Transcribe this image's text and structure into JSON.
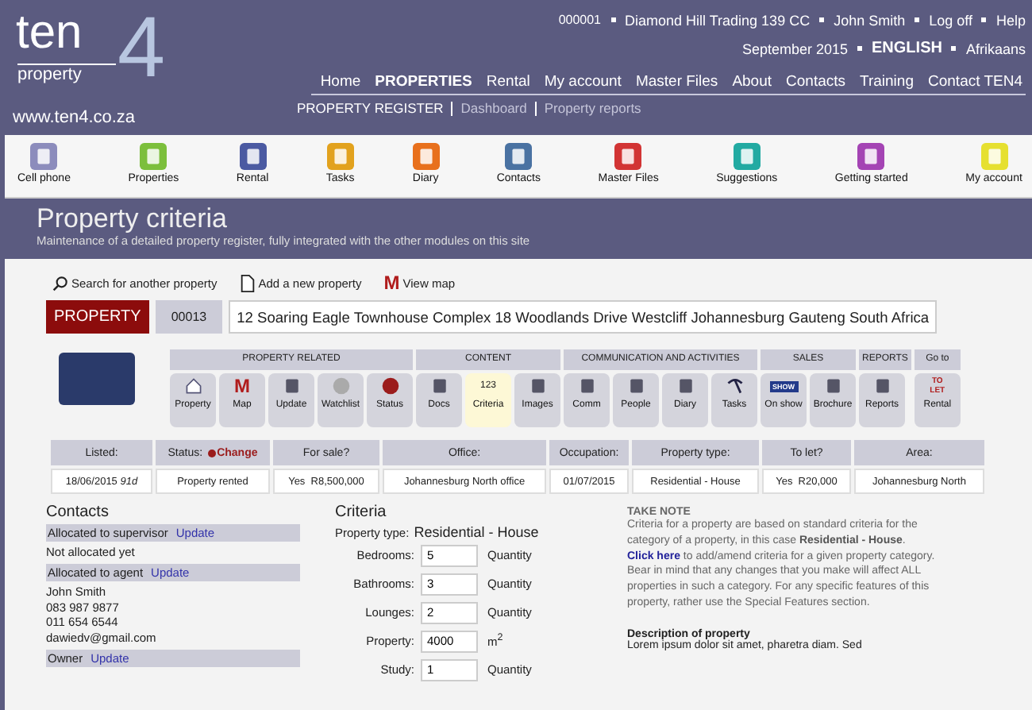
{
  "logo": {
    "word": "ten",
    "sub": "property",
    "numeral": "4",
    "url": "www.ten4.co.za"
  },
  "account": {
    "code": "000001",
    "company": "Diamond Hill Trading 139 CC",
    "user": "John Smith",
    "logoff": "Log off",
    "help": "Help"
  },
  "period": "September 2015",
  "languages": [
    {
      "label": "ENGLISH",
      "selected": true
    },
    {
      "label": "Afrikaans",
      "selected": false
    }
  ],
  "nav": [
    {
      "label": "Home",
      "selected": false
    },
    {
      "label": "PROPERTIES",
      "selected": true
    },
    {
      "label": "Rental",
      "selected": false
    },
    {
      "label": "My account",
      "selected": false
    },
    {
      "label": "Master Files",
      "selected": false
    },
    {
      "label": "About",
      "selected": false
    },
    {
      "label": "Contacts",
      "selected": false
    },
    {
      "label": "Training",
      "selected": false
    },
    {
      "label": "Contact TEN4",
      "selected": false
    }
  ],
  "subnav": [
    {
      "label": "PROPERTY REGISTER",
      "selected": true
    },
    {
      "label": "Dashboard",
      "selected": false
    },
    {
      "label": "Property reports",
      "selected": false
    }
  ],
  "toolbar": [
    {
      "label": "Cell phone",
      "color": "#8c8cbc"
    },
    {
      "label": "Properties",
      "color": "#7cbf3c"
    },
    {
      "label": "Rental",
      "color": "#4b5aa2"
    },
    {
      "label": "Tasks",
      "color": "#e2a21e"
    },
    {
      "label": "Diary",
      "color": "#e8701c"
    },
    {
      "label": "Contacts",
      "color": "#4a72a2"
    },
    {
      "label": "Master Files",
      "color": "#d23434"
    },
    {
      "label": "Suggestions",
      "color": "#22aaa2"
    },
    {
      "label": "Getting started",
      "color": "#a444b4"
    },
    {
      "label": "My account",
      "color": "#e6e030"
    }
  ],
  "page": {
    "title": "Property criteria",
    "subtitle": "Maintenance of a detailed property register, fully integrated with the other modules on this site"
  },
  "actions": [
    {
      "kind": "search",
      "label": "Search for another property"
    },
    {
      "kind": "add",
      "label": "Add a new property"
    },
    {
      "kind": "map",
      "glyph": "M",
      "label": "View map"
    }
  ],
  "property": {
    "tag": "PROPERTY",
    "number": "00013",
    "address": "12 Soaring Eagle Townhouse Complex 18 Woodlands Drive Westcliff Johannesburg Gauteng South Africa"
  },
  "modules": [
    {
      "title": "PROPERTY RELATED",
      "buttons": [
        {
          "label": "Property",
          "selected": false
        },
        {
          "label": "Map",
          "selected": false,
          "glyph": "M"
        },
        {
          "label": "Update",
          "selected": false
        },
        {
          "label": "Watchlist",
          "selected": false
        },
        {
          "label": "Status",
          "selected": false
        }
      ]
    },
    {
      "title": "CONTENT",
      "buttons": [
        {
          "label": "Docs",
          "selected": false
        },
        {
          "label": "Criteria",
          "selected": true,
          "glyph": "123"
        },
        {
          "label": "Images",
          "selected": false
        }
      ]
    },
    {
      "title": "COMMUNICATION AND ACTIVITIES",
      "buttons": [
        {
          "label": "Comm",
          "selected": false
        },
        {
          "label": "People",
          "selected": false
        },
        {
          "label": "Diary",
          "selected": false
        },
        {
          "label": "Tasks",
          "selected": false
        }
      ]
    },
    {
      "title": "SALES",
      "buttons": [
        {
          "label": "On show",
          "selected": false,
          "glyph": "SHOW"
        },
        {
          "label": "Brochure",
          "selected": false
        }
      ]
    },
    {
      "title": "REPORTS",
      "buttons": [
        {
          "label": "Reports",
          "selected": false
        }
      ]
    },
    {
      "title": "Go to",
      "buttons": [
        {
          "label": "Rental",
          "selected": false,
          "glyph": "TO LET"
        }
      ]
    }
  ],
  "summary": {
    "columns": [
      {
        "label": "Listed:"
      },
      {
        "label": "Status:",
        "link": "Change"
      },
      {
        "label": "For sale?"
      },
      {
        "label": "Office:"
      },
      {
        "label": "Occupation:"
      },
      {
        "label": "Property type:"
      },
      {
        "label": "To let?"
      },
      {
        "label": "Area:"
      }
    ],
    "values": [
      "18/06/2015 *91d*",
      "Property rented",
      "Yes  R8,500,000",
      "Johannesburg North office",
      "01/07/2015",
      "Residential - House",
      "Yes  R20,000",
      "Johannesburg North"
    ]
  },
  "contacts": {
    "title": "Contacts",
    "items": [
      {
        "kind": "header",
        "label": "Allocated to supervisor",
        "link": "Update"
      },
      {
        "kind": "line",
        "text": "Not allocated yet"
      },
      {
        "kind": "header",
        "label": "Allocated to agent",
        "link": "Update"
      },
      {
        "kind": "person",
        "lines": [
          "John Smith",
          "083 987 9877",
          "011 654 6544",
          "dawiedv@gmail.com"
        ]
      },
      {
        "kind": "header",
        "label": "Owner",
        "link": "Update"
      }
    ]
  },
  "criteria": {
    "title": "Criteria",
    "type_label": "Property type:",
    "type_value": "Residential - House",
    "fields": [
      {
        "label": "Bedrooms:",
        "value": "5",
        "unit": "Quantity"
      },
      {
        "label": "Bathrooms:",
        "value": "3",
        "unit": "Quantity"
      },
      {
        "label": "Lounges:",
        "value": "2",
        "unit": "Quantity"
      },
      {
        "label": "Property:",
        "value": "4000",
        "unit": "m$^{2}$"
      },
      {
        "label": "Study:",
        "value": "1",
        "unit": "Quantity"
      }
    ]
  },
  "note": {
    "title": "TAKE NOTE",
    "before": "Criteria for a property are based on standard criteria for the category of a property, in this case **Residential - House**. ",
    "link": "Click here",
    "after": " to add/amend criteria for a given property category. Bear in mind that any changes that you make will affect ALL properties in such a category. For any specific features of this property, rather use the Special Features section."
  },
  "description": {
    "title": "Description of property",
    "text": "Lorem ipsum dolor sit amet, pharetra diam. Sed"
  }
}
